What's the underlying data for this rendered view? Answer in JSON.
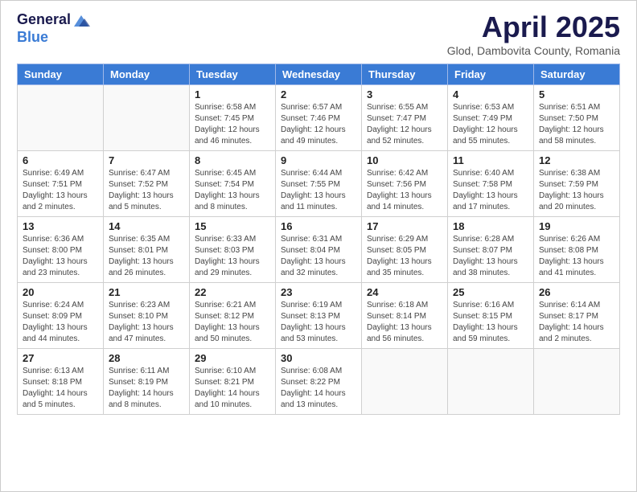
{
  "logo": {
    "general": "General",
    "blue": "Blue"
  },
  "title": "April 2025",
  "subtitle": "Glod, Dambovita County, Romania",
  "days_of_week": [
    "Sunday",
    "Monday",
    "Tuesday",
    "Wednesday",
    "Thursday",
    "Friday",
    "Saturday"
  ],
  "weeks": [
    [
      {
        "day": "",
        "info": ""
      },
      {
        "day": "",
        "info": ""
      },
      {
        "day": "1",
        "info": "Sunrise: 6:58 AM\nSunset: 7:45 PM\nDaylight: 12 hours and 46 minutes."
      },
      {
        "day": "2",
        "info": "Sunrise: 6:57 AM\nSunset: 7:46 PM\nDaylight: 12 hours and 49 minutes."
      },
      {
        "day": "3",
        "info": "Sunrise: 6:55 AM\nSunset: 7:47 PM\nDaylight: 12 hours and 52 minutes."
      },
      {
        "day": "4",
        "info": "Sunrise: 6:53 AM\nSunset: 7:49 PM\nDaylight: 12 hours and 55 minutes."
      },
      {
        "day": "5",
        "info": "Sunrise: 6:51 AM\nSunset: 7:50 PM\nDaylight: 12 hours and 58 minutes."
      }
    ],
    [
      {
        "day": "6",
        "info": "Sunrise: 6:49 AM\nSunset: 7:51 PM\nDaylight: 13 hours and 2 minutes."
      },
      {
        "day": "7",
        "info": "Sunrise: 6:47 AM\nSunset: 7:52 PM\nDaylight: 13 hours and 5 minutes."
      },
      {
        "day": "8",
        "info": "Sunrise: 6:45 AM\nSunset: 7:54 PM\nDaylight: 13 hours and 8 minutes."
      },
      {
        "day": "9",
        "info": "Sunrise: 6:44 AM\nSunset: 7:55 PM\nDaylight: 13 hours and 11 minutes."
      },
      {
        "day": "10",
        "info": "Sunrise: 6:42 AM\nSunset: 7:56 PM\nDaylight: 13 hours and 14 minutes."
      },
      {
        "day": "11",
        "info": "Sunrise: 6:40 AM\nSunset: 7:58 PM\nDaylight: 13 hours and 17 minutes."
      },
      {
        "day": "12",
        "info": "Sunrise: 6:38 AM\nSunset: 7:59 PM\nDaylight: 13 hours and 20 minutes."
      }
    ],
    [
      {
        "day": "13",
        "info": "Sunrise: 6:36 AM\nSunset: 8:00 PM\nDaylight: 13 hours and 23 minutes."
      },
      {
        "day": "14",
        "info": "Sunrise: 6:35 AM\nSunset: 8:01 PM\nDaylight: 13 hours and 26 minutes."
      },
      {
        "day": "15",
        "info": "Sunrise: 6:33 AM\nSunset: 8:03 PM\nDaylight: 13 hours and 29 minutes."
      },
      {
        "day": "16",
        "info": "Sunrise: 6:31 AM\nSunset: 8:04 PM\nDaylight: 13 hours and 32 minutes."
      },
      {
        "day": "17",
        "info": "Sunrise: 6:29 AM\nSunset: 8:05 PM\nDaylight: 13 hours and 35 minutes."
      },
      {
        "day": "18",
        "info": "Sunrise: 6:28 AM\nSunset: 8:07 PM\nDaylight: 13 hours and 38 minutes."
      },
      {
        "day": "19",
        "info": "Sunrise: 6:26 AM\nSunset: 8:08 PM\nDaylight: 13 hours and 41 minutes."
      }
    ],
    [
      {
        "day": "20",
        "info": "Sunrise: 6:24 AM\nSunset: 8:09 PM\nDaylight: 13 hours and 44 minutes."
      },
      {
        "day": "21",
        "info": "Sunrise: 6:23 AM\nSunset: 8:10 PM\nDaylight: 13 hours and 47 minutes."
      },
      {
        "day": "22",
        "info": "Sunrise: 6:21 AM\nSunset: 8:12 PM\nDaylight: 13 hours and 50 minutes."
      },
      {
        "day": "23",
        "info": "Sunrise: 6:19 AM\nSunset: 8:13 PM\nDaylight: 13 hours and 53 minutes."
      },
      {
        "day": "24",
        "info": "Sunrise: 6:18 AM\nSunset: 8:14 PM\nDaylight: 13 hours and 56 minutes."
      },
      {
        "day": "25",
        "info": "Sunrise: 6:16 AM\nSunset: 8:15 PM\nDaylight: 13 hours and 59 minutes."
      },
      {
        "day": "26",
        "info": "Sunrise: 6:14 AM\nSunset: 8:17 PM\nDaylight: 14 hours and 2 minutes."
      }
    ],
    [
      {
        "day": "27",
        "info": "Sunrise: 6:13 AM\nSunset: 8:18 PM\nDaylight: 14 hours and 5 minutes."
      },
      {
        "day": "28",
        "info": "Sunrise: 6:11 AM\nSunset: 8:19 PM\nDaylight: 14 hours and 8 minutes."
      },
      {
        "day": "29",
        "info": "Sunrise: 6:10 AM\nSunset: 8:21 PM\nDaylight: 14 hours and 10 minutes."
      },
      {
        "day": "30",
        "info": "Sunrise: 6:08 AM\nSunset: 8:22 PM\nDaylight: 14 hours and 13 minutes."
      },
      {
        "day": "",
        "info": ""
      },
      {
        "day": "",
        "info": ""
      },
      {
        "day": "",
        "info": ""
      }
    ]
  ]
}
